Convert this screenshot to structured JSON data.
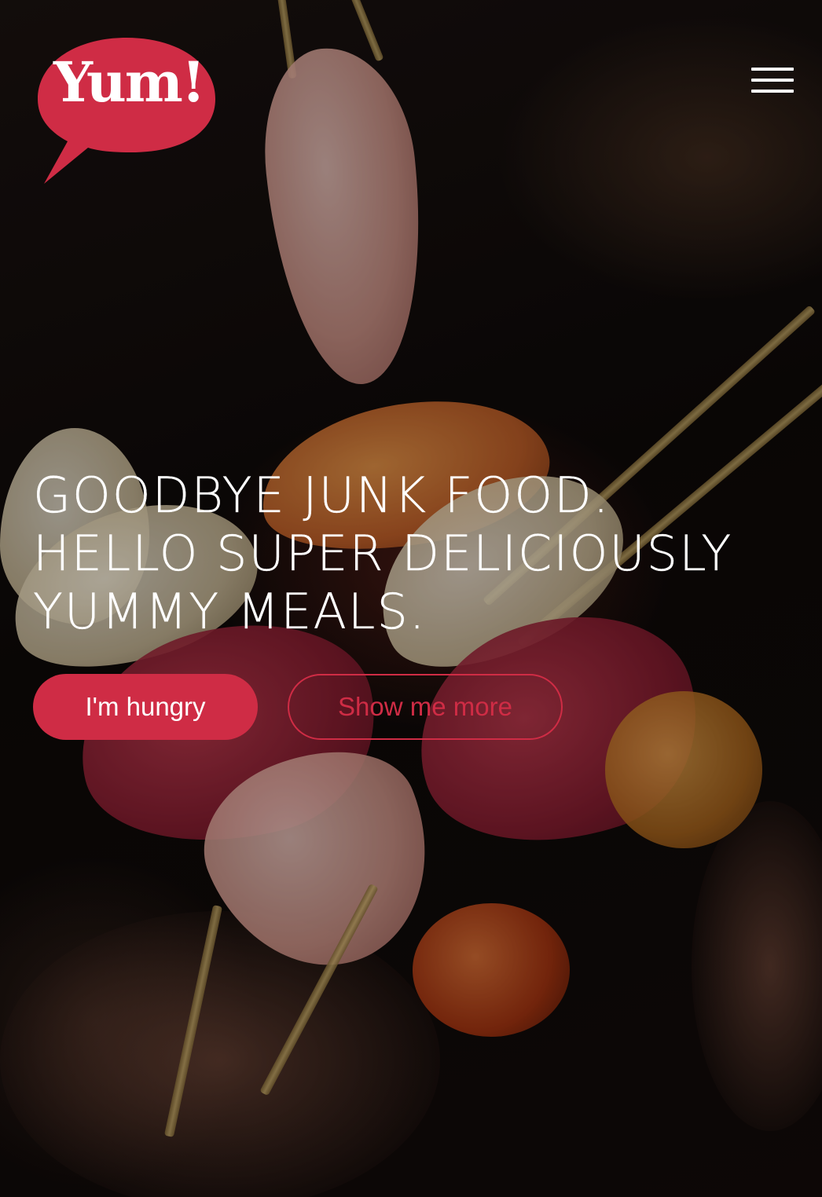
{
  "brand": {
    "logo_text": "Yum!",
    "accent_color": "#cf2c45"
  },
  "header": {
    "menu_icon": "hamburger-menu-icon"
  },
  "hero": {
    "headline_lines": [
      "GOODBYE JUNK FOOD.",
      "HELLO SUPER DELICIOUSLY",
      "YUMMY MEALS."
    ],
    "primary_button_label": "I'm hungry",
    "secondary_button_label": "Show me more"
  }
}
